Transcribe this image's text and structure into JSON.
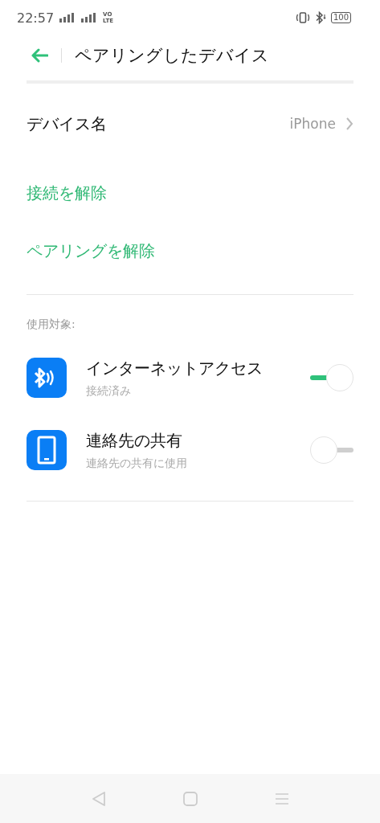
{
  "status_bar": {
    "time": "22:57",
    "volte_top": "VO",
    "volte_bottom": "LTE",
    "battery": "100"
  },
  "header": {
    "title": "ペアリングしたデバイス"
  },
  "rows": [
    {
      "kind": "value",
      "label": "デバイス名",
      "value": "iPhone"
    },
    {
      "kind": "action",
      "label": "接続を解除"
    },
    {
      "kind": "action",
      "label": "ペアリングを解除"
    }
  ],
  "section": {
    "title": "使用対象:",
    "items": [
      {
        "kind": "bluetooth",
        "title": "インターネットアクセス",
        "subtitle": "接続済み",
        "on": true
      },
      {
        "kind": "phone",
        "title": "連絡先の共有",
        "subtitle": "連絡先の共有に使用",
        "on": false
      }
    ]
  }
}
